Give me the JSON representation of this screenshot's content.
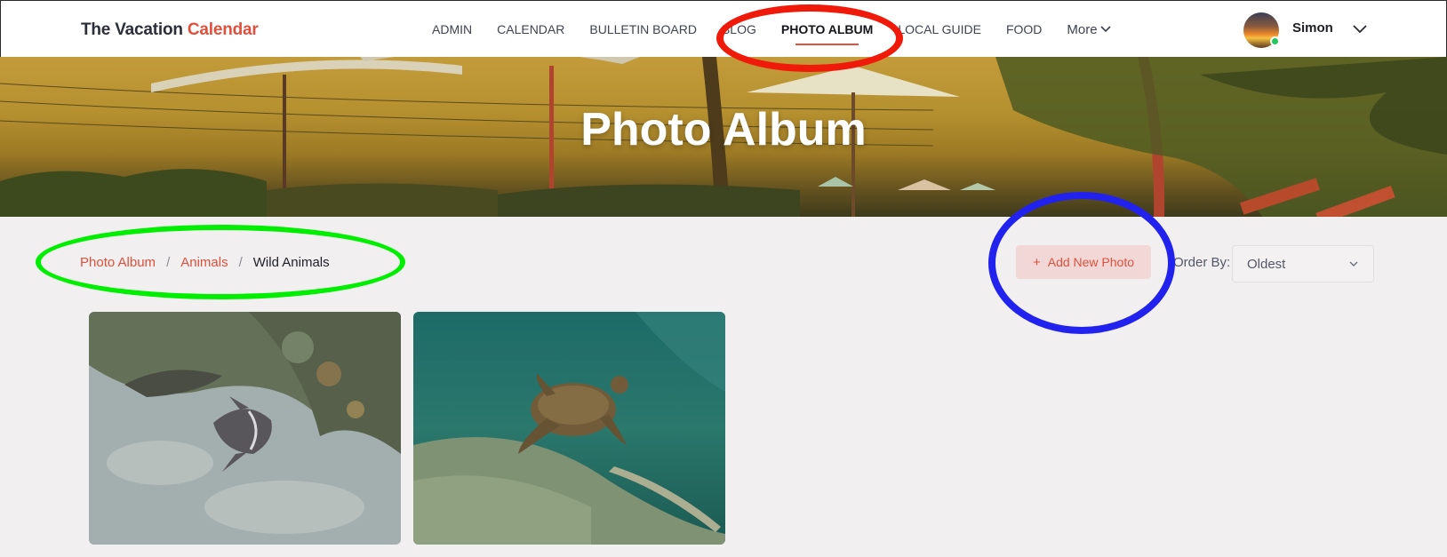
{
  "header": {
    "brand_primary": "The Vacation",
    "brand_accent": "Calendar",
    "nav": [
      {
        "label": "ADMIN"
      },
      {
        "label": "CALENDAR"
      },
      {
        "label": "BULLETIN BOARD"
      },
      {
        "label": "BLOG"
      },
      {
        "label": "PHOTO ALBUM",
        "active": true
      },
      {
        "label": "LOCAL GUIDE"
      },
      {
        "label": "FOOD"
      }
    ],
    "more_label": "More",
    "user": {
      "name": "Simon",
      "status": "online"
    }
  },
  "hero": {
    "title": "Photo Album"
  },
  "breadcrumb": {
    "items": [
      "Photo Album",
      "Animals"
    ],
    "current": "Wild Animals"
  },
  "actions": {
    "add_photo_icon": "+",
    "add_photo_label": "Add New Photo",
    "order_by_label": "Order By:",
    "order_by_value": "Oldest"
  },
  "photos": [
    {
      "subject": "angelfish-reef"
    },
    {
      "subject": "sea-turtle"
    }
  ],
  "colors": {
    "accent": "#e0503c",
    "annotation_red": "#f01a0a",
    "annotation_green": "#00ee00",
    "annotation_blue": "#2222ee"
  }
}
